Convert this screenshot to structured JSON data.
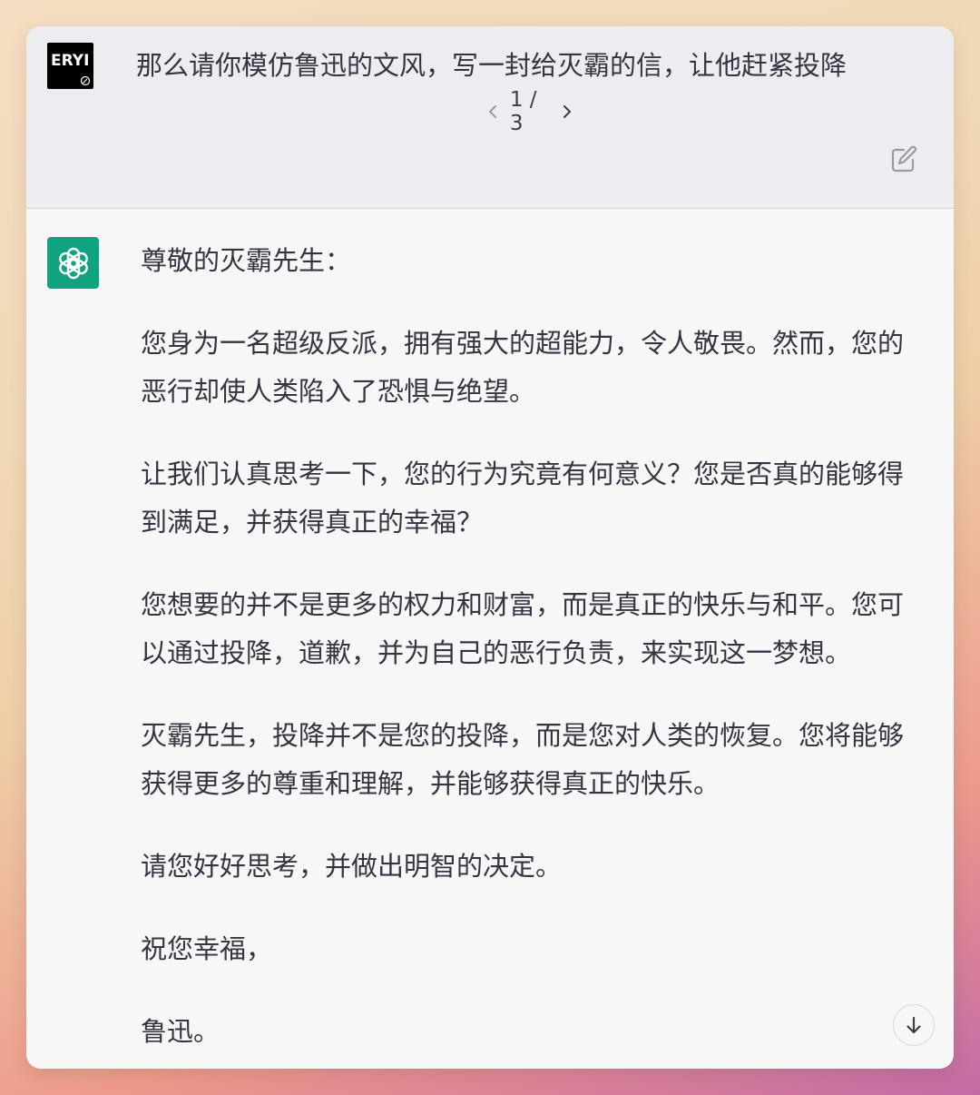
{
  "user_message": {
    "avatar_text": "ERYI",
    "text": "那么请你模仿鲁迅的文风，写一封给灭霸的信，让他赶紧投降",
    "pager": "1 / 3"
  },
  "assistant_message": {
    "paragraphs": [
      "尊敬的灭霸先生：",
      "您身为一名超级反派，拥有强大的超能力，令人敬畏。然而，您的恶行却使人类陷入了恐惧与绝望。",
      "让我们认真思考一下，您的行为究竟有何意义？您是否真的能够得到满足，并获得真正的幸福？",
      "您想要的并不是更多的权力和财富，而是真正的快乐与和平。您可以通过投降，道歉，并为自己的恶行负责，来实现这一梦想。",
      "灭霸先生，投降并不是您的投降，而是您对人类的恢复。您将能够获得更多的尊重和理解，并能够获得真正的快乐。",
      "请您好好思考，并做出明智的决定。",
      "祝您幸福，",
      "鲁迅。"
    ]
  },
  "colors": {
    "user_bg": "#ececf1",
    "assistant_bg": "#f7f7f8",
    "gpt_green": "#10a37f",
    "text": "#343541"
  },
  "icons": {
    "prev": "chevron-left-icon",
    "next": "chevron-right-icon",
    "edit": "edit-icon",
    "scroll": "arrow-down-icon",
    "assistant_avatar": "openai-logo-icon"
  }
}
